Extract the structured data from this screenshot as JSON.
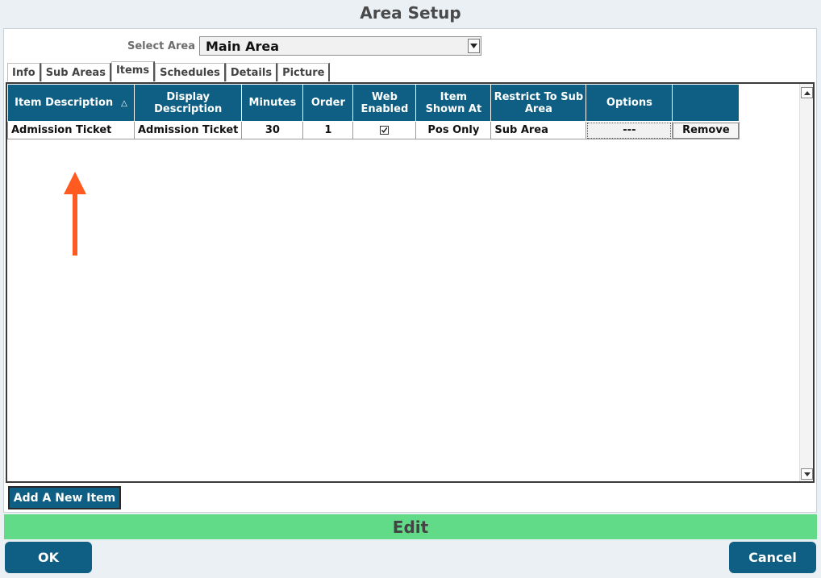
{
  "window": {
    "title": "Area Setup"
  },
  "area_select": {
    "label": "Select Area",
    "value": "Main Area"
  },
  "tabs": [
    {
      "label": "Info",
      "active": false
    },
    {
      "label": "Sub Areas",
      "active": false
    },
    {
      "label": "Items",
      "active": true
    },
    {
      "label": "Schedules",
      "active": false
    },
    {
      "label": "Details",
      "active": false
    },
    {
      "label": "Picture",
      "active": false
    }
  ],
  "grid": {
    "columns": [
      {
        "label": "Item Description",
        "sort": "ascending"
      },
      {
        "label": "Display Description"
      },
      {
        "label": "Minutes"
      },
      {
        "label": "Order"
      },
      {
        "label": "Web Enabled"
      },
      {
        "label": "Item Shown At"
      },
      {
        "label": "Restrict To Sub Area"
      },
      {
        "label": "Options"
      },
      {
        "label": ""
      }
    ],
    "sort_indicator": "△",
    "rows": [
      {
        "item_description": "Admission Ticket",
        "display_description": "Admission Ticket",
        "minutes": "30",
        "order": "1",
        "web_enabled": true,
        "item_shown_at": "Pos Only",
        "restrict_to_sub_area": "Sub Area",
        "options": "---",
        "remove_label": "Remove"
      }
    ]
  },
  "annotation": {
    "color": "#ff5a1f"
  },
  "actions": {
    "add_item": "Add A New Item"
  },
  "status_bar": {
    "mode": "Edit",
    "color": "#62db88"
  },
  "footer": {
    "ok": "OK",
    "cancel": "Cancel"
  },
  "theme": {
    "accent": "#0e5f83",
    "background": "#eaf0f4"
  }
}
